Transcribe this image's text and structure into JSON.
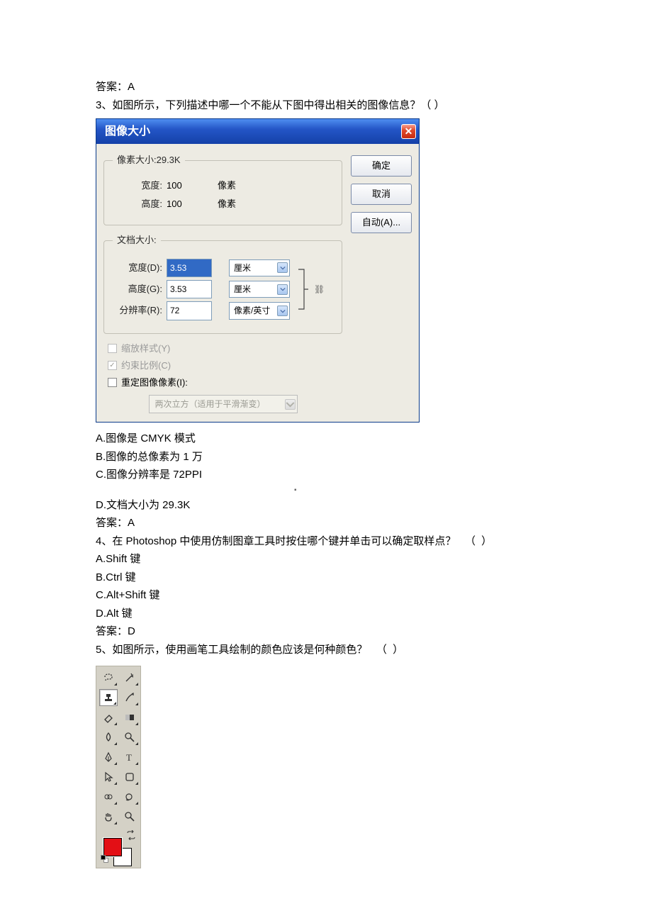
{
  "answer_prefix": "答案：",
  "q2": {
    "answer": "A"
  },
  "q3": {
    "stem_a": "3、如图所示，下列描述中哪一个不能从下图中得出相关的图像信息？（",
    "stem_b": "）",
    "A": "A.图像是 CMYK 模式",
    "B": "B.图像的总像素为 1 万",
    "C": "C.图像分辨率是 72PPI",
    "D": "D.文档大小为 29.3K",
    "answer": "A"
  },
  "q4": {
    "stem_a": "4、在 Photoshop 中使用仿制图章工具时按住哪个键并单击可以确定取样点？",
    "stem_b": "（",
    "stem_c": "）",
    "A": "A.Shift 键",
    "B": "B.Ctrl 键",
    "C": "C.Alt+Shift 键",
    "D": "D.Alt 键",
    "answer": "D"
  },
  "q5": {
    "stem_a": "5、如图所示，使用画笔工具绘制的颜色应该是何种颜色？",
    "stem_b": "（",
    "stem_c": "）"
  },
  "dialog": {
    "title": "图像大小",
    "ok": "确定",
    "cancel": "取消",
    "auto": "自动(A)...",
    "pixel_legend": "像素大小:29.3K",
    "width_label": "宽度:",
    "height_label": "高度:",
    "width_val": "100",
    "height_val": "100",
    "pixel_unit": "像素",
    "doc_legend": "文档大小:",
    "width_d": "宽度(D):",
    "height_g": "高度(G):",
    "res_r": "分辨率(R):",
    "doc_w": "3.53",
    "doc_h": "3.53",
    "res": "72",
    "cm": "厘米",
    "ppi": "像素/英寸",
    "scale_styles": "缩放样式(Y)",
    "constrain": "约束比例(C)",
    "resample_img": "重定图像像素(I):",
    "resample_method": "两次立方（适用于平滑渐变）"
  },
  "tools": {
    "lasso": "lasso-icon",
    "wand": "wand-icon",
    "stamp": "stamp-icon",
    "history": "history-brush-icon",
    "eraser": "eraser-icon",
    "gradient": "gradient-icon",
    "blur": "blur-icon",
    "dodge": "dodge-icon",
    "pen": "pen-icon",
    "type": "type-icon",
    "path": "path-select-icon",
    "shape": "shape-icon",
    "notes": "notes-icon",
    "eyedropper": "eyedropper-icon",
    "hand": "hand-icon",
    "zoom": "zoom-icon"
  },
  "small_dot": "▪"
}
